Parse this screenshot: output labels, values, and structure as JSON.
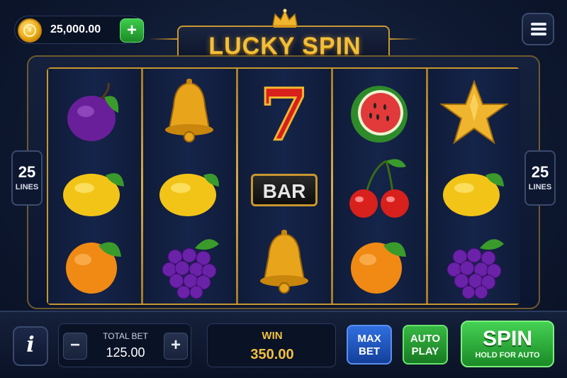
{
  "header": {
    "balance": "25,000.00",
    "add_label": "+",
    "coin_glyph": "¥",
    "title": "LUCKY SPIN"
  },
  "paylines": {
    "left": {
      "count": "25",
      "label": "LINES"
    },
    "right": {
      "count": "25",
      "label": "LINES"
    }
  },
  "reels": [
    [
      "plum",
      "lemon",
      "orange"
    ],
    [
      "bell",
      "lemon",
      "grapes"
    ],
    [
      "seven",
      "bar",
      "bell"
    ],
    [
      "watermelon",
      "cherries",
      "orange"
    ],
    [
      "star",
      "lemon",
      "grapes"
    ]
  ],
  "bar_symbol_text": "BAR",
  "seven_symbol_text": "7",
  "controls": {
    "info_label": "i",
    "total_bet_label": "TOTAL BET",
    "total_bet_value": "125.00",
    "decrease_label": "−",
    "increase_label": "+",
    "win_label": "WIN",
    "win_value": "350.00",
    "max_bet_line1": "MAX",
    "max_bet_line2": "BET",
    "auto_play_line1": "AUTO",
    "auto_play_line2": "PLAY",
    "spin_label": "SPIN",
    "spin_sublabel": "HOLD FOR AUTO"
  },
  "colors": {
    "gold": "#c9972e",
    "title": "#f3bf3a",
    "spin_green": "#2fae3b",
    "max_bet_blue": "#2f6fe0"
  }
}
